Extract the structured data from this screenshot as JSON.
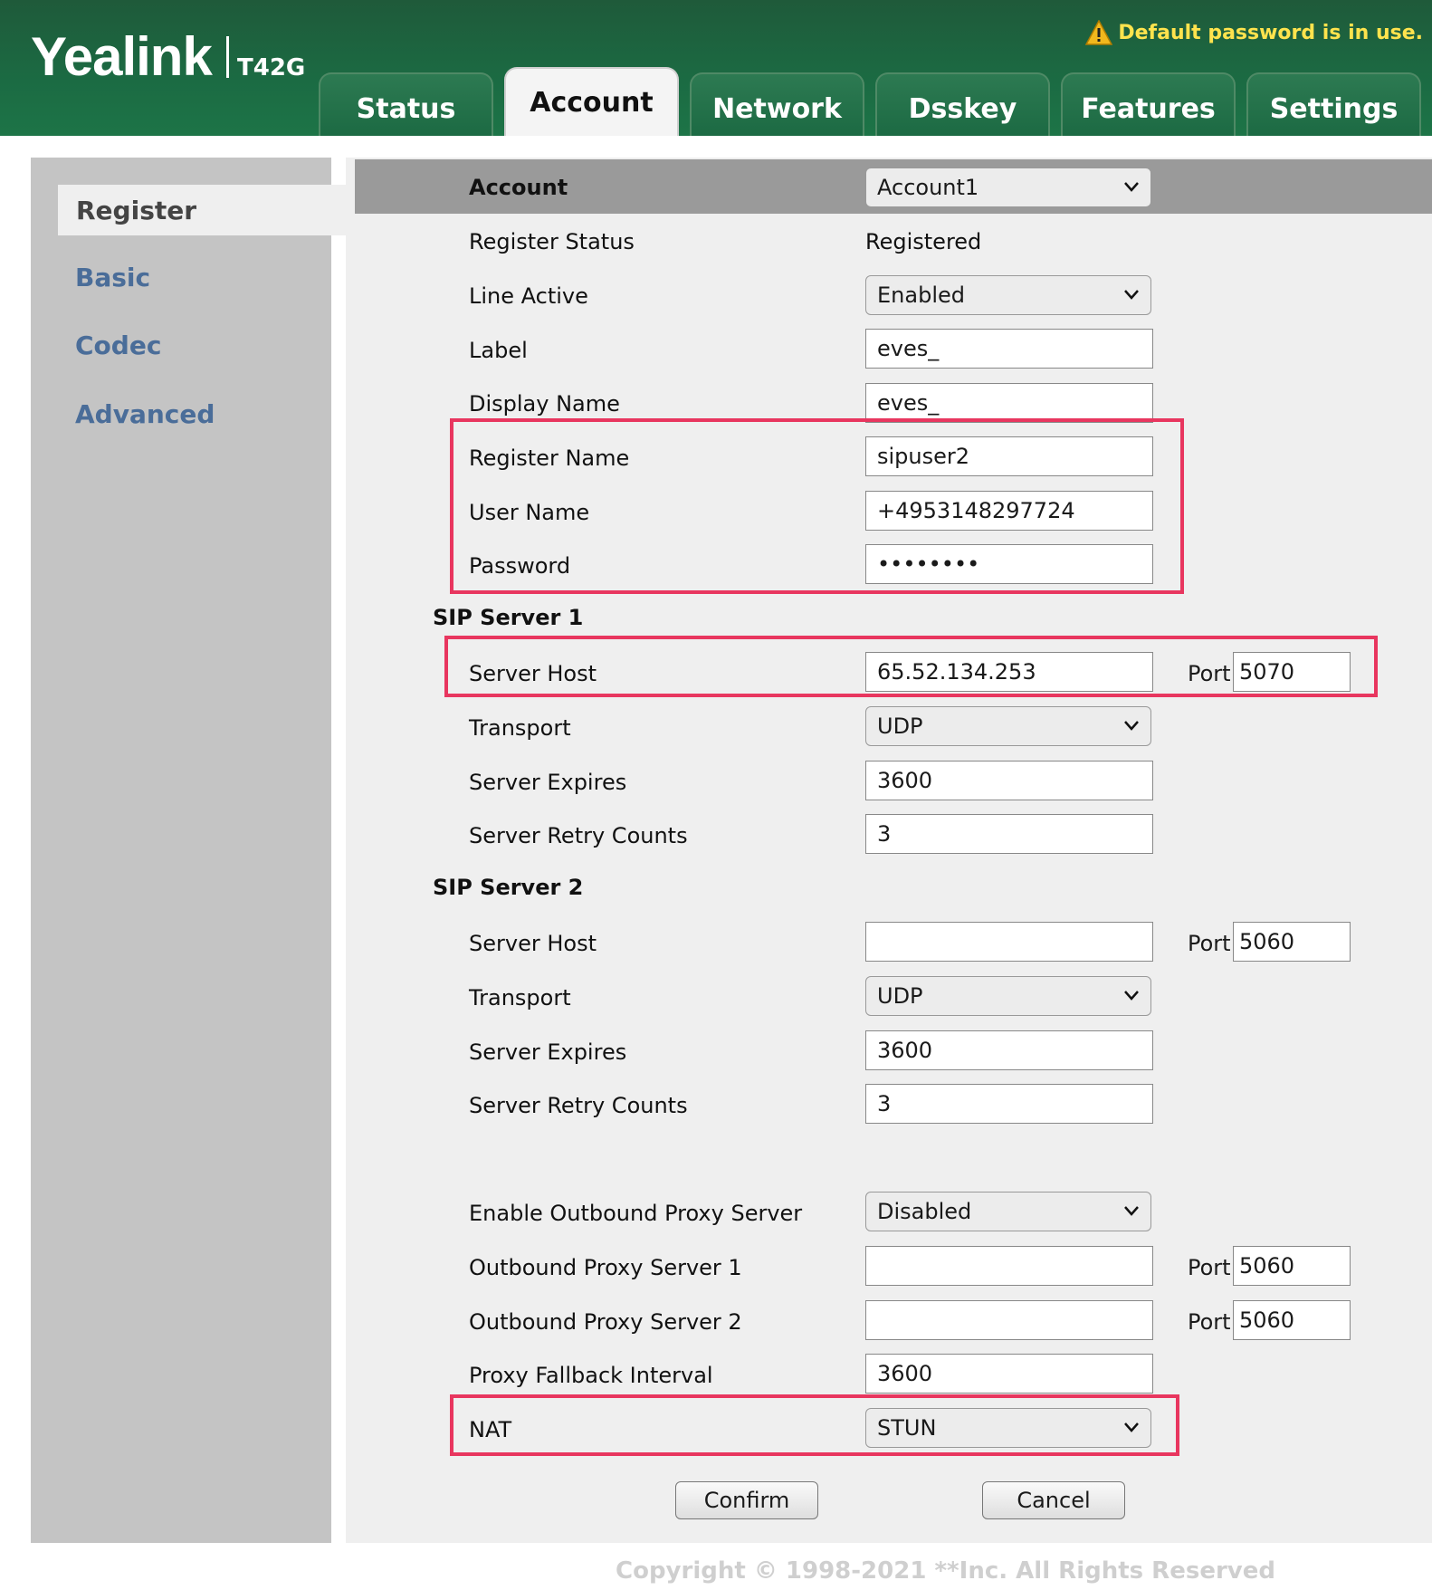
{
  "header": {
    "brand": "Yealink",
    "model": "T42G",
    "warning": "Default password is in use."
  },
  "tabs": [
    {
      "label": "Status"
    },
    {
      "label": "Account"
    },
    {
      "label": "Network"
    },
    {
      "label": "Dsskey"
    },
    {
      "label": "Features"
    },
    {
      "label": "Settings"
    }
  ],
  "active_tab": "Account",
  "sidebar": {
    "items": [
      {
        "label": "Register"
      },
      {
        "label": "Basic"
      },
      {
        "label": "Codec"
      },
      {
        "label": "Advanced"
      }
    ]
  },
  "form": {
    "account": {
      "label": "Account",
      "value": "Account1"
    },
    "register_status": {
      "label": "Register Status",
      "value": "Registered"
    },
    "line_active": {
      "label": "Line Active",
      "value": "Enabled"
    },
    "label": {
      "label": "Label",
      "value": "eves_"
    },
    "display_name": {
      "label": "Display Name",
      "value": "eves_"
    },
    "register_name": {
      "label": "Register Name",
      "value": "sipuser2"
    },
    "user_name": {
      "label": "User Name",
      "value": "+4953148297724"
    },
    "password": {
      "label": "Password",
      "value": "••••••••"
    },
    "sip1": {
      "title": "SIP Server 1",
      "server_host": {
        "label": "Server Host",
        "value": "65.52.134.253"
      },
      "port": {
        "label": "Port",
        "value": "5070"
      },
      "transport": {
        "label": "Transport",
        "value": "UDP"
      },
      "server_expires": {
        "label": "Server Expires",
        "value": "3600"
      },
      "retry_counts": {
        "label": "Server Retry Counts",
        "value": "3"
      }
    },
    "sip2": {
      "title": "SIP Server 2",
      "server_host": {
        "label": "Server Host",
        "value": ""
      },
      "port": {
        "label": "Port",
        "value": "5060"
      },
      "transport": {
        "label": "Transport",
        "value": "UDP"
      },
      "server_expires": {
        "label": "Server Expires",
        "value": "3600"
      },
      "retry_counts": {
        "label": "Server Retry Counts",
        "value": "3"
      }
    },
    "outbound_enable": {
      "label": "Enable Outbound Proxy Server",
      "value": "Disabled"
    },
    "outbound1": {
      "label": "Outbound Proxy Server 1",
      "value": "",
      "port_label": "Port",
      "port": "5060"
    },
    "outbound2": {
      "label": "Outbound Proxy Server 2",
      "value": "",
      "port_label": "Port",
      "port": "5060"
    },
    "fallback": {
      "label": "Proxy Fallback Interval",
      "value": "3600"
    },
    "nat": {
      "label": "NAT",
      "value": "STUN"
    }
  },
  "buttons": {
    "confirm": "Confirm",
    "cancel": "Cancel"
  },
  "footer": "Copyright © 1998-2021 **Inc. All Rights Reserved",
  "colors": {
    "header_green": "#1b6b43",
    "highlight": "#e8365f",
    "nav_link": "#4a6d99",
    "warning": "#ffe34d"
  }
}
